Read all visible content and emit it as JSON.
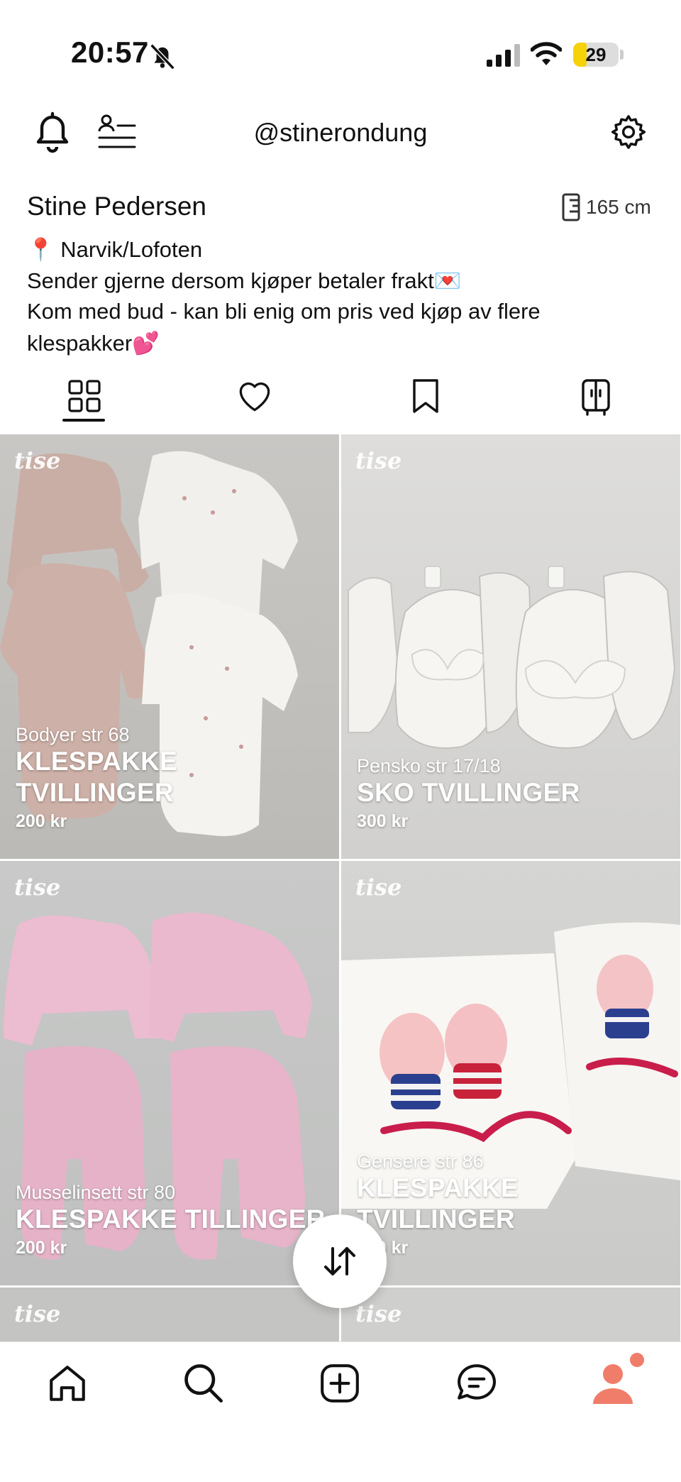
{
  "status_bar": {
    "time": "20:57",
    "battery_level": "29",
    "battery_fraction": 0.29
  },
  "header": {
    "username": "@stinerondung"
  },
  "profile": {
    "name": "Stine Pedersen",
    "height": "165 cm",
    "bio_lines": [
      "📍 Narvik/Lofoten",
      "Sender gjerne dersom kjøper betaler frakt💌",
      "Kom med bud - kan bli enig om pris ved kjøp av flere",
      "klespakker💕"
    ]
  },
  "tabs": [
    {
      "icon": "grid-icon",
      "active": true
    },
    {
      "icon": "heart-icon",
      "active": false
    },
    {
      "icon": "bookmark-icon",
      "active": false
    },
    {
      "icon": "wardrobe-icon",
      "active": false
    }
  ],
  "listings": [
    {
      "subtitle": "Bodyer str 68",
      "title_lines": [
        "KLESPAKKE",
        "TVILLINGER"
      ],
      "price": "200 kr",
      "watermark": "tise"
    },
    {
      "subtitle": "Pensko str 17/18",
      "title_lines": [
        "SKO TVILLINGER"
      ],
      "price": "300 kr",
      "watermark": "tise"
    },
    {
      "subtitle": "Musselinsett str 80",
      "title_lines": [
        "KLESPAKKE TILLINGER"
      ],
      "price": "200 kr",
      "watermark": "tise"
    },
    {
      "subtitle": "Gensere str 86",
      "title_lines": [
        "KLESPAKKE",
        "TVILLINGER"
      ],
      "price": "200 kr",
      "watermark": "tise"
    }
  ],
  "partial_row": [
    {
      "watermark": "tise"
    },
    {
      "watermark": "tise"
    }
  ],
  "colors": {
    "accent": "#f07d6a",
    "battery": "#f5d20a"
  },
  "bottom_nav": [
    {
      "icon": "home-icon"
    },
    {
      "icon": "search-icon"
    },
    {
      "icon": "add-listing-icon"
    },
    {
      "icon": "messages-icon"
    },
    {
      "icon": "profile-icon"
    }
  ]
}
